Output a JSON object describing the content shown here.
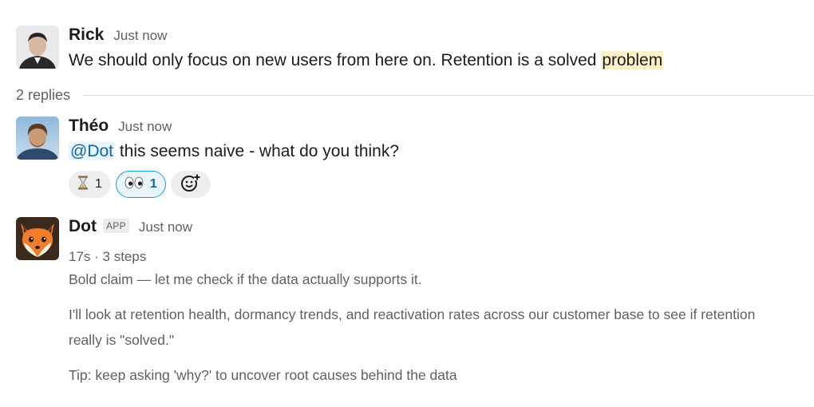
{
  "messages": {
    "rick": {
      "author": "Rick",
      "time": "Just now",
      "text_before": "We should only focus on new users from here on. Retention is a solved ",
      "text_highlight": "problem"
    },
    "replies": {
      "label": "2 replies"
    },
    "theo": {
      "author": "Théo",
      "time": "Just now",
      "mention": "@Dot",
      "text": " this seems naive - what do you think?",
      "reactions": [
        {
          "emoji": "hourglass-icon",
          "count": "1",
          "active": false
        },
        {
          "emoji": "eyes-icon",
          "count": "1",
          "active": true
        }
      ]
    },
    "dot": {
      "author": "Dot",
      "badge": "APP",
      "time": "Just now",
      "meta": "17s · 3 steps",
      "paragraphs": [
        "Bold claim — let me check if the data actually supports it.",
        "I'll look at retention health, dormancy trends, and reactivation rates across our customer base to see if retention really is \"solved.\"",
        "Tip: keep asking 'why?' to uncover root causes behind the data"
      ]
    }
  },
  "colors": {
    "mention_bg": "#e8f5fa",
    "mention_text": "#1264a3",
    "highlight_bg": "#fdf1c9",
    "active_reaction_border": "#1d9bd1"
  }
}
